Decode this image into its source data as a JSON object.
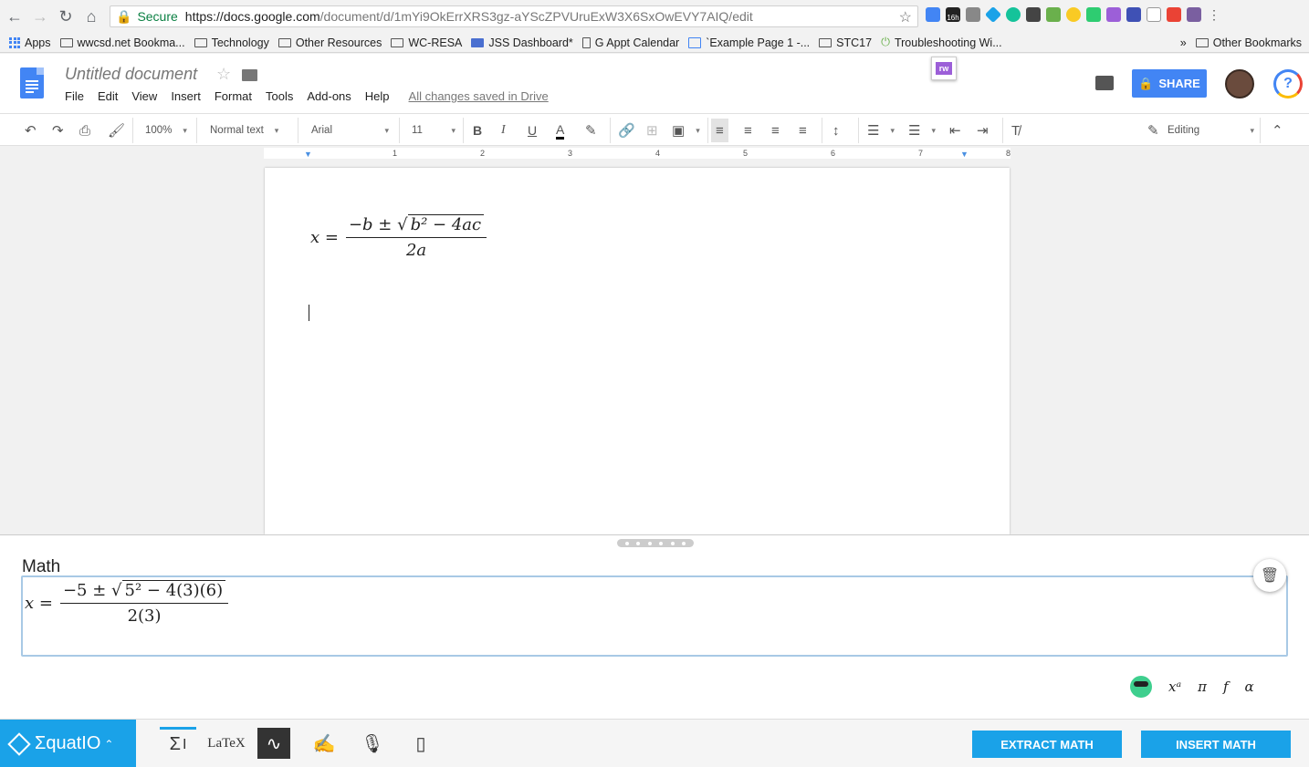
{
  "browser": {
    "secure_label": "Secure",
    "url_host": "https://docs.google.com",
    "url_path": "/document/d/1mYi9OkErrXRS3gz-aYScZPVUruExW3X6SxOwEVY7AIQ/edit",
    "extension_badge": "16h"
  },
  "bookmarks": [
    "Apps",
    "wwcsd.net Bookma...",
    "Technology",
    "Other Resources",
    "WC-RESA",
    "JSS Dashboard*",
    "G Appt Calendar",
    "`Example Page 1 -...",
    "STC17",
    "Troubleshooting Wi..."
  ],
  "bookmarks_more": "»",
  "other_bookmarks": "Other Bookmarks",
  "doc": {
    "title": "Untitled document",
    "menu": [
      "File",
      "Edit",
      "View",
      "Insert",
      "Format",
      "Tools",
      "Add-ons",
      "Help"
    ],
    "saved_status": "All changes saved in Drive",
    "share_label": "SHARE",
    "rw_label": "rw",
    "help_label": "?"
  },
  "toolbar": {
    "zoom": "100%",
    "style": "Normal text",
    "font": "Arial",
    "size": "11",
    "editing_mode": "Editing",
    "bold": "B",
    "italic": "I",
    "underline": "U",
    "text_color": "A"
  },
  "ruler": [
    "1",
    "2",
    "3",
    "4",
    "5",
    "6",
    "7",
    "8"
  ],
  "document_equation": {
    "lhs": "x =",
    "numerator_pre": "−b ± √",
    "numerator_radicand": "b² − 4ac",
    "denominator": "2a"
  },
  "math_panel": {
    "label": "Math",
    "equation": {
      "lhs": "x =",
      "numerator_pre": "−5 ± √",
      "numerator_radicand": "5² − 4(3)(6)",
      "denominator": "2(3)"
    },
    "symbols": [
      "xᵃ",
      "π",
      "f",
      "α"
    ]
  },
  "equatio": {
    "brand": "ΣquatIO",
    "modes": [
      "Σ",
      "LaTeX"
    ],
    "extract_label": "EXTRACT MATH",
    "insert_label": "INSERT MATH"
  },
  "colors": {
    "accent": "#1aa2e8",
    "share": "#4285f4"
  }
}
